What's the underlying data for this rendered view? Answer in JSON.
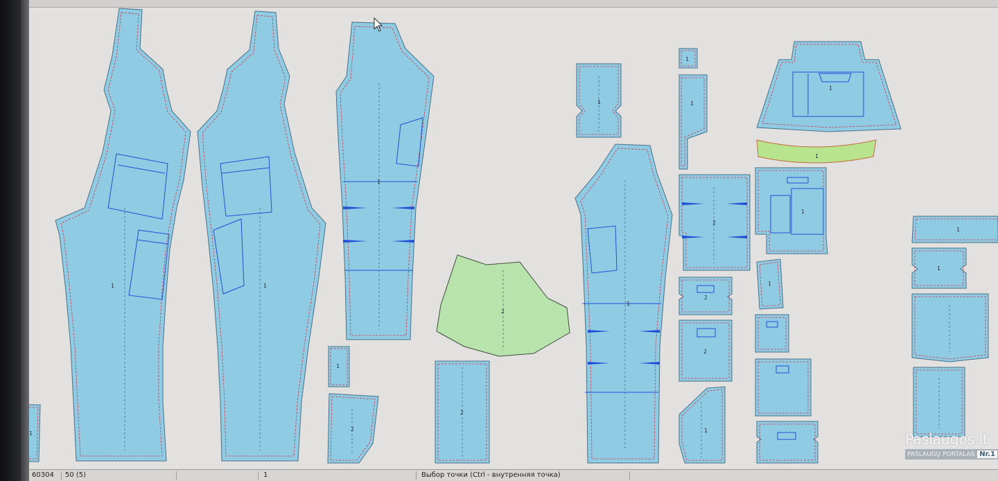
{
  "status_bar": {
    "code": "60304",
    "scale": "50 (5)",
    "count": "1",
    "hint": "Выбор точки (Ctrl - внутренняя точка)"
  },
  "pieces": {
    "front_left": "1",
    "front_right": "1",
    "back_trouser": "1",
    "small_strip": "1",
    "small_rect": "1",
    "angled_pocket": "2",
    "skirt_green": "2",
    "tall_rect": "2",
    "notched_rect": "1",
    "tall_leg": "1",
    "top_small_square": "1",
    "top_strip": "1",
    "hood_piece": "1",
    "yellow_band": "1",
    "pocket_big": "2",
    "pocket_med": "2",
    "pocket_sq": "2",
    "pocket_angled": "1",
    "double_pocket": "1",
    "small_tab": "1",
    "right_band": "1",
    "right_notched": "1",
    "right_big": "1",
    "right_bottom": "1"
  },
  "watermark": {
    "brand": "Paslaugos.lt",
    "tagline": "PASLAUGŲ PORTALAS",
    "badge": "Nr.1"
  },
  "colors": {
    "piece_fill": "#8fcbe3",
    "green_fill": "#b9e3ad",
    "yellow_fill": "#b8e38f",
    "seam_color": "#d3324a",
    "detail_color": "#1f4fd6",
    "canvas": "#e3e1df"
  }
}
